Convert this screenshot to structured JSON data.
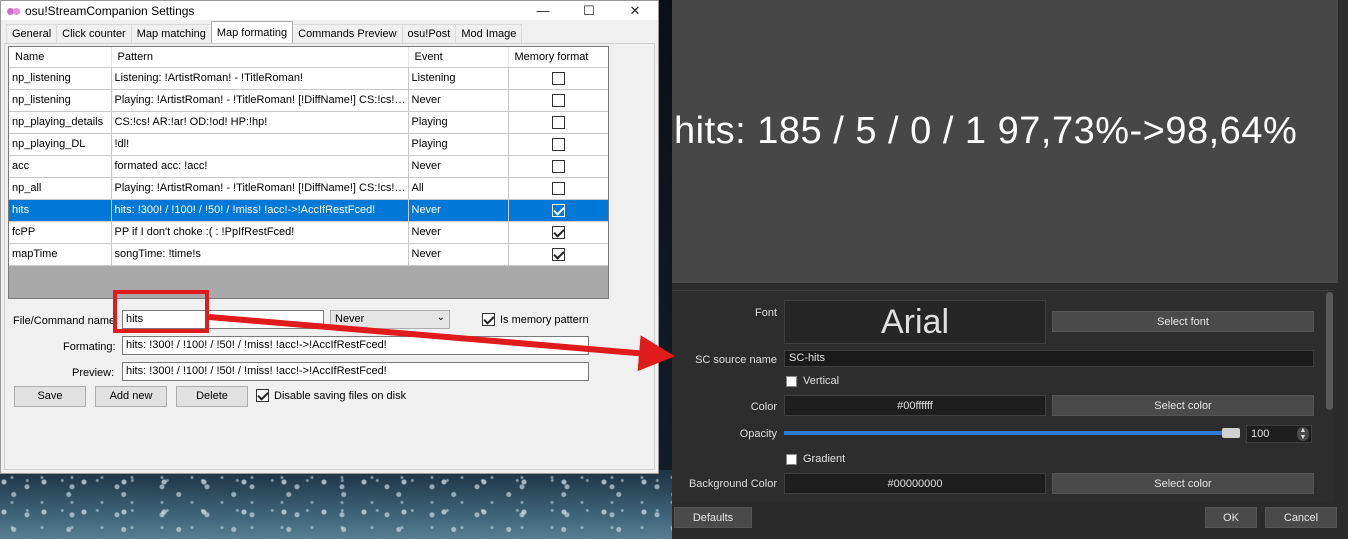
{
  "window": {
    "title": "osu!StreamCompanion Settings",
    "minimize": "—",
    "maximize": "☐",
    "close": "✕"
  },
  "tabs": [
    "General",
    "Click counter",
    "Map matching",
    "Map formating",
    "Commands Preview",
    "osu!Post",
    "Mod Image"
  ],
  "grid": {
    "columns": [
      "Name",
      "Pattern",
      "Event",
      "Memory format"
    ],
    "rows": [
      {
        "name": "np_listening",
        "pattern": "Listening: !ArtistRoman! - !TitleRoman!",
        "event": "Listening",
        "memory": false
      },
      {
        "name": "np_listening",
        "pattern": "Playing: !ArtistRoman! - !TitleRoman! [!DiffName!] CS:!cs! A...",
        "event": "Never",
        "memory": false
      },
      {
        "name": "np_playing_details",
        "pattern": "CS:!cs! AR:!ar! OD:!od! HP:!hp!",
        "event": "Playing",
        "memory": false
      },
      {
        "name": "np_playing_DL",
        "pattern": "!dl!",
        "event": "Playing",
        "memory": false
      },
      {
        "name": "acc",
        "pattern": "formated acc: !acc!",
        "event": "Never",
        "memory": false
      },
      {
        "name": "np_all",
        "pattern": "Playing: !ArtistRoman! - !TitleRoman! [!DiffName!] CS:!cs! AR:!...",
        "event": "All",
        "memory": false
      },
      {
        "name": "hits",
        "pattern": "hits: !300! / !100! / !50! / !miss!  !acc!->!AccIfRestFced!",
        "event": "Never",
        "memory": true
      },
      {
        "name": "fcPP",
        "pattern": "PP if I don't choke :( : !PpIfRestFced!",
        "event": "Never",
        "memory": true
      },
      {
        "name": "mapTime",
        "pattern": "songTime: !time!s",
        "event": "Never",
        "memory": true
      }
    ]
  },
  "form": {
    "name_label": "File/Command name:",
    "name_value": "hits",
    "event_value": "Never",
    "is_memory_label": "Is memory pattern",
    "formatting_label": "Formating:",
    "formatting_value": "hits: !300! / !100! / !50! / !miss!  !acc!->!AccIfRestFced!",
    "preview_label": "Preview:",
    "preview_value": "hits: !300! / !100! / !50! / !miss!  !acc!->!AccIfRestFced!",
    "save": "Save",
    "add_new": "Add new",
    "delete": "Delete",
    "disable_saving": "Disable saving files on disk"
  },
  "obs": {
    "preview_text": "hits: 185 / 5 / 0 / 1  97,73%->98,64%",
    "font_label": "Font",
    "font_value": "Arial",
    "select_font": "Select font",
    "source_name_label": "SC source name",
    "source_name_value": "SC-hits",
    "vertical_label": "Vertical",
    "color_label": "Color",
    "color_value": "#00ffffff",
    "select_color": "Select color",
    "opacity_label": "Opacity",
    "opacity_value": "100",
    "opacity_fraction": 1.0,
    "gradient_label": "Gradient",
    "bg_color_label": "Background Color",
    "bg_color_value": "#00000000",
    "select_bg_color": "Select color",
    "defaults": "Defaults",
    "ok": "OK",
    "cancel": "Cancel"
  },
  "colors": {
    "selection": "#0078d7",
    "highlight": "#e01b1b",
    "obs_accent": "#2e7cd6"
  }
}
